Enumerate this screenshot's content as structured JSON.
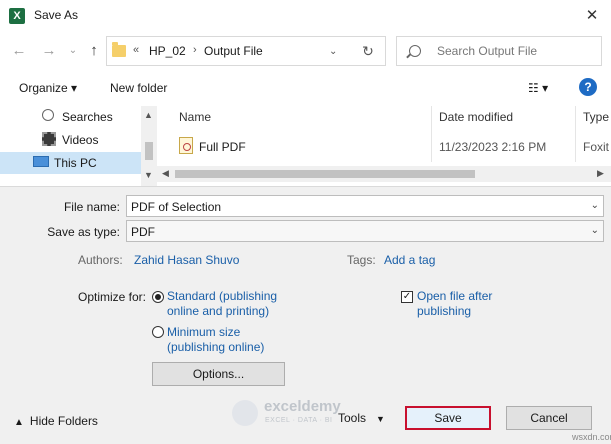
{
  "window": {
    "title": "Save As",
    "app_icon_letter": "X"
  },
  "nav": {
    "address_overflow": "«",
    "breadcrumb": [
      "HP_02",
      "Output File"
    ],
    "search_placeholder": "Search Output File"
  },
  "toolbar": {
    "organize": "Organize ▾",
    "new_folder": "New folder",
    "help": "?"
  },
  "sidebar": {
    "items": [
      {
        "label": "Searches"
      },
      {
        "label": "Videos"
      },
      {
        "label": "This PC",
        "selected": true
      }
    ]
  },
  "files": {
    "columns": [
      "Name",
      "Date modified",
      "Type"
    ],
    "rows": [
      {
        "name": "Full PDF",
        "date": "11/23/2023 2:16 PM",
        "type": "Foxit"
      }
    ]
  },
  "form": {
    "file_name_label": "File name:",
    "file_name_value": "PDF of Selection",
    "save_type_label": "Save as type:",
    "save_type_value": "PDF",
    "authors_label": "Authors:",
    "authors_value": "Zahid Hasan Shuvo",
    "tags_label": "Tags:",
    "tags_value": "Add a tag",
    "optimize_label": "Optimize for:",
    "opt_standard_line1": "Standard (publishing",
    "opt_standard_line2": "online and printing)",
    "opt_minimum_line1": "Minimum size",
    "opt_minimum_line2": "(publishing online)",
    "open_after_line1": "Open file after",
    "open_after_line2": "publishing",
    "options_button": "Options..."
  },
  "footer": {
    "hide_folders": "Hide Folders",
    "tools": "Tools",
    "save": "Save",
    "cancel": "Cancel"
  },
  "watermark": {
    "name": "exceldemy",
    "tagline": "EXCEL · DATA · BI"
  },
  "site_mark": "wsxdn.com"
}
